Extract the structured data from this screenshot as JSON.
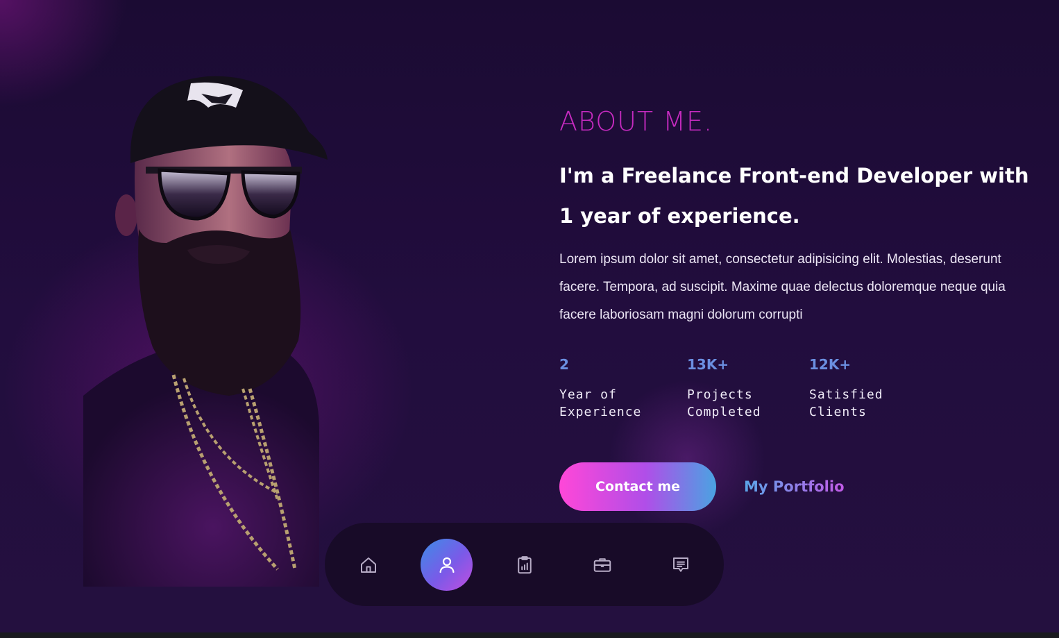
{
  "about": {
    "title": "ABOUT ME.",
    "headline": "I'm a Freelance Front-end Developer with 1 year of experience.",
    "description": "Lorem ipsum dolor sit amet, consectetur adipisicing elit. Molestias, deserunt facere. Tempora, ad suscipit. Maxime quae delectus doloremque neque quia facere laboriosam magni dolorum corrupti"
  },
  "stats": [
    {
      "value": "2",
      "label": "Year of\nExperience"
    },
    {
      "value": "13K+",
      "label": "Projects\nCompleted"
    },
    {
      "value": "12K+",
      "label": "Satisfied\nClients"
    }
  ],
  "actions": {
    "contact_label": "Contact me",
    "portfolio_label": "My Portfolio"
  },
  "nav": {
    "items": [
      {
        "icon": "home-icon",
        "active": false
      },
      {
        "icon": "user-icon",
        "active": true
      },
      {
        "icon": "clipboard-chart-icon",
        "active": false
      },
      {
        "icon": "briefcase-icon",
        "active": false
      },
      {
        "icon": "message-icon",
        "active": false
      }
    ]
  },
  "colors": {
    "accent_magenta": "#c62bc0",
    "stat_blue": "#6b8fe0",
    "gradient_start": "#ff47d8",
    "gradient_end": "#4aa3e2",
    "background": "#1c0c35"
  }
}
